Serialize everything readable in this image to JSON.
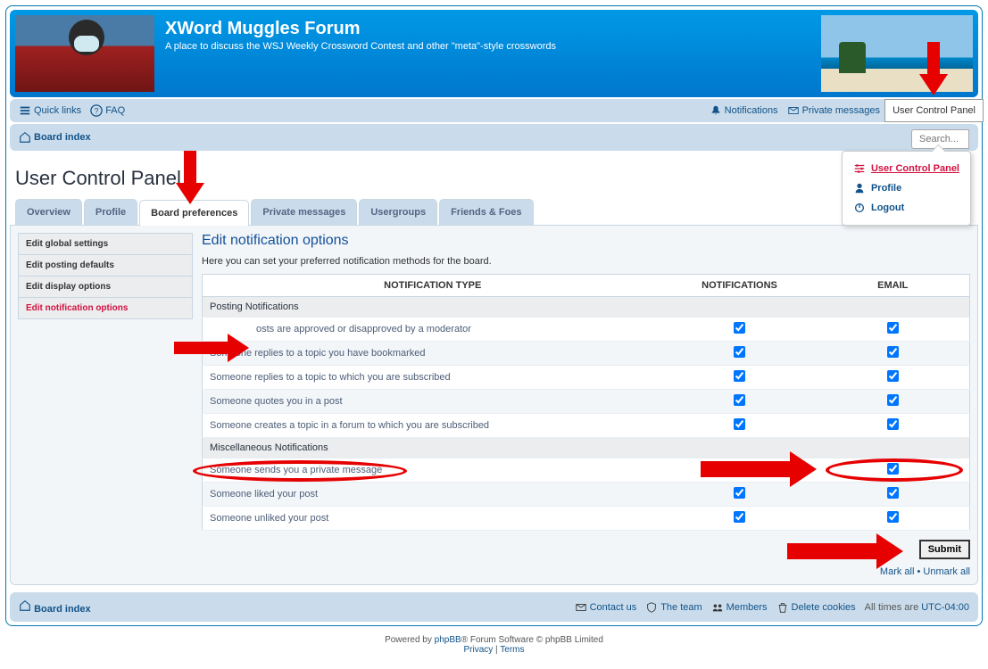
{
  "header": {
    "title": "XWord Muggles Forum",
    "subtitle": "A place to discuss the WSJ Weekly Crossword Contest and other \"meta\"-style crosswords"
  },
  "nav": {
    "quick_links": "Quick links",
    "faq": "FAQ",
    "notifications": "Notifications",
    "private_messages": "Private messages",
    "ucp_tooltip": "User Control Panel",
    "board_index": "Board index",
    "search_placeholder": "Search..."
  },
  "dropdown": {
    "ucp": "User Control Panel",
    "profile": "Profile",
    "logout": "Logout"
  },
  "page_title": "User Control Panel",
  "tabs": [
    "Overview",
    "Profile",
    "Board preferences",
    "Private messages",
    "Usergroups",
    "Friends & Foes"
  ],
  "active_tab": 2,
  "side_menu": [
    "Edit global settings",
    "Edit posting defaults",
    "Edit display options",
    "Edit notification options"
  ],
  "active_side": 3,
  "content": {
    "heading": "Edit notification options",
    "intro": "Here you can set your preferred notification methods for the board.",
    "th_type": "NOTIFICATION TYPE",
    "th_notif": "NOTIFICATIONS",
    "th_email": "EMAIL",
    "sections": [
      {
        "title": "Posting Notifications",
        "rows": [
          {
            "label": "osts are approved or disapproved by a moderator",
            "n": true,
            "e": true,
            "obscured": true
          },
          {
            "label": "Someone replies to a topic you have bookmarked",
            "n": true,
            "e": true
          },
          {
            "label": "Someone replies to a topic to which you are subscribed",
            "n": true,
            "e": true
          },
          {
            "label": "Someone quotes you in a post",
            "n": true,
            "e": true
          },
          {
            "label": "Someone creates a topic in a forum to which you are subscribed",
            "n": true,
            "e": true
          }
        ]
      },
      {
        "title": "Miscellaneous Notifications",
        "rows": [
          {
            "label": "Someone sends you a private message",
            "n": true,
            "e": true
          },
          {
            "label": "Someone liked your post",
            "n": true,
            "e": true
          },
          {
            "label": "Someone unliked your post",
            "n": true,
            "e": true
          }
        ]
      }
    ],
    "submit": "Submit",
    "mark_all": "Mark all",
    "unmark_all": "Unmark all"
  },
  "footer": {
    "board_index": "Board index",
    "contact": "Contact us",
    "team": "The team",
    "members": "Members",
    "delete_cookies": "Delete cookies",
    "time_text": "All times are",
    "tz": "UTC-04:00"
  },
  "copyright": {
    "powered": "Powered by",
    "phpbb": "phpBB",
    "rest": "® Forum Software © phpBB Limited",
    "privacy": "Privacy",
    "terms": "Terms"
  }
}
